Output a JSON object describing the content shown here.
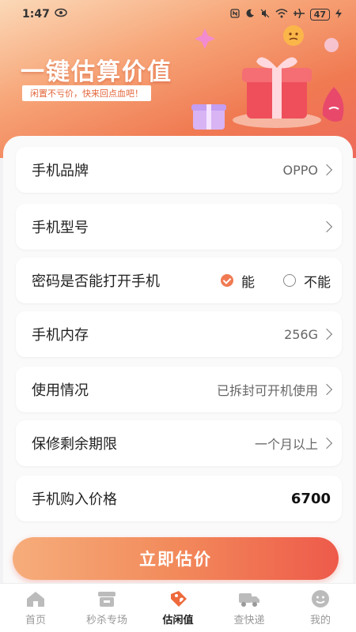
{
  "status_bar": {
    "time": "1:47",
    "battery": "47"
  },
  "hero": {
    "title": "一键估算价值",
    "subtitle": "闲置不亏价，快来回点血吧！"
  },
  "form": {
    "brand": {
      "label": "手机品牌",
      "value": "OPPO"
    },
    "model": {
      "label": "手机型号",
      "value": ""
    },
    "password": {
      "label": "密码是否能打开手机",
      "option_yes": "能",
      "option_no": "不能",
      "selected": "yes"
    },
    "storage": {
      "label": "手机内存",
      "value": "256G"
    },
    "usage": {
      "label": "使用情况",
      "value": "已拆封可开机使用"
    },
    "warranty": {
      "label": "保修剩余期限",
      "value": "一个月以上"
    },
    "price": {
      "label": "手机购入价格",
      "value": "6700"
    }
  },
  "cta": {
    "label": "立即估价"
  },
  "tabs": [
    {
      "label": "首页",
      "icon": "home-icon"
    },
    {
      "label": "秒杀专场",
      "icon": "store-icon"
    },
    {
      "label": "估闲值",
      "icon": "tag-icon"
    },
    {
      "label": "查快递",
      "icon": "truck-icon"
    },
    {
      "label": "我的",
      "icon": "smile-icon"
    }
  ],
  "colors": {
    "accent": "#f07a52",
    "cta_start": "#f6ad7b",
    "cta_end": "#ee5a4a"
  }
}
